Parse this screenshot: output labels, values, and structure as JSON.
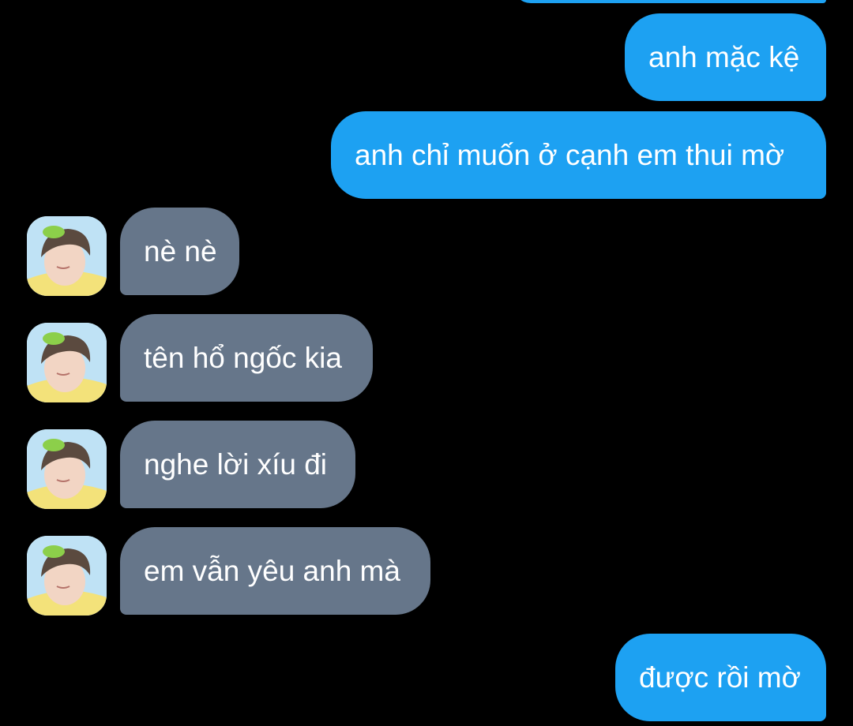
{
  "messages": [
    {
      "type": "sent",
      "text": ""
    },
    {
      "type": "sent",
      "text": "anh mặc kệ"
    },
    {
      "type": "sent",
      "text": "anh chỉ muốn ở cạnh em thui mờ"
    },
    {
      "type": "received",
      "text": "nè nè",
      "avatar": "profile-photo"
    },
    {
      "type": "received",
      "text": "tên hổ ngốc kia",
      "avatar": "profile-photo"
    },
    {
      "type": "received",
      "text": "nghe lời xíu đi",
      "avatar": "profile-photo"
    },
    {
      "type": "received",
      "text": "em vẫn yêu anh mà",
      "avatar": "profile-photo"
    },
    {
      "type": "sent",
      "text": "được rồi mờ"
    }
  ],
  "colors": {
    "background": "#000000",
    "sent_bubble": "#1da1f2",
    "received_bubble": "#66768a",
    "text": "#ffffff"
  }
}
